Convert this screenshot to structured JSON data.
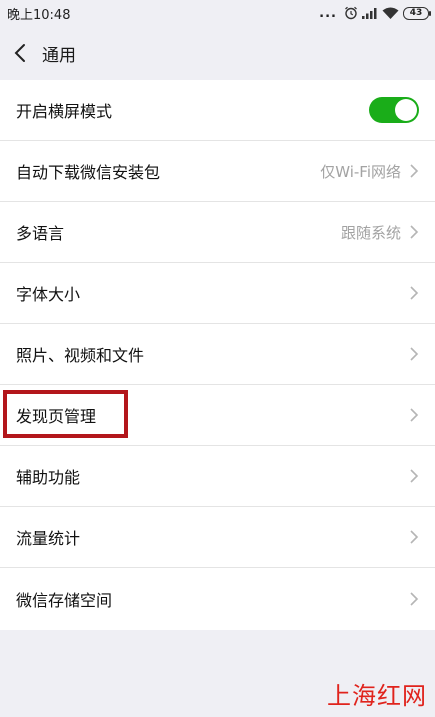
{
  "status_bar": {
    "time": "晚上10:48",
    "dots": "...",
    "battery": "43",
    "icons": [
      "alarm-icon",
      "signal-icon",
      "wifi-icon",
      "battery-icon"
    ]
  },
  "nav": {
    "title": "通用",
    "back_icon": "chevron-left-icon"
  },
  "settings": {
    "rows": [
      {
        "label": "开启横屏模式",
        "type": "toggle",
        "toggle_on": true
      },
      {
        "label": "自动下载微信安装包",
        "type": "value",
        "value": "仅Wi-Fi网络"
      },
      {
        "label": "多语言",
        "type": "value",
        "value": "跟随系统"
      },
      {
        "label": "字体大小",
        "type": "link"
      },
      {
        "label": "照片、视频和文件",
        "type": "link"
      },
      {
        "label": "发现页管理",
        "type": "link",
        "highlighted": true
      },
      {
        "label": "辅助功能",
        "type": "link"
      },
      {
        "label": "流量统计",
        "type": "link"
      },
      {
        "label": "微信存储空间",
        "type": "link"
      }
    ]
  },
  "colors": {
    "toggle_on": "#1aad19",
    "highlight": "#b3161b",
    "watermark": "#e0231c",
    "background": "#efeff4"
  },
  "watermark": "上海红网"
}
